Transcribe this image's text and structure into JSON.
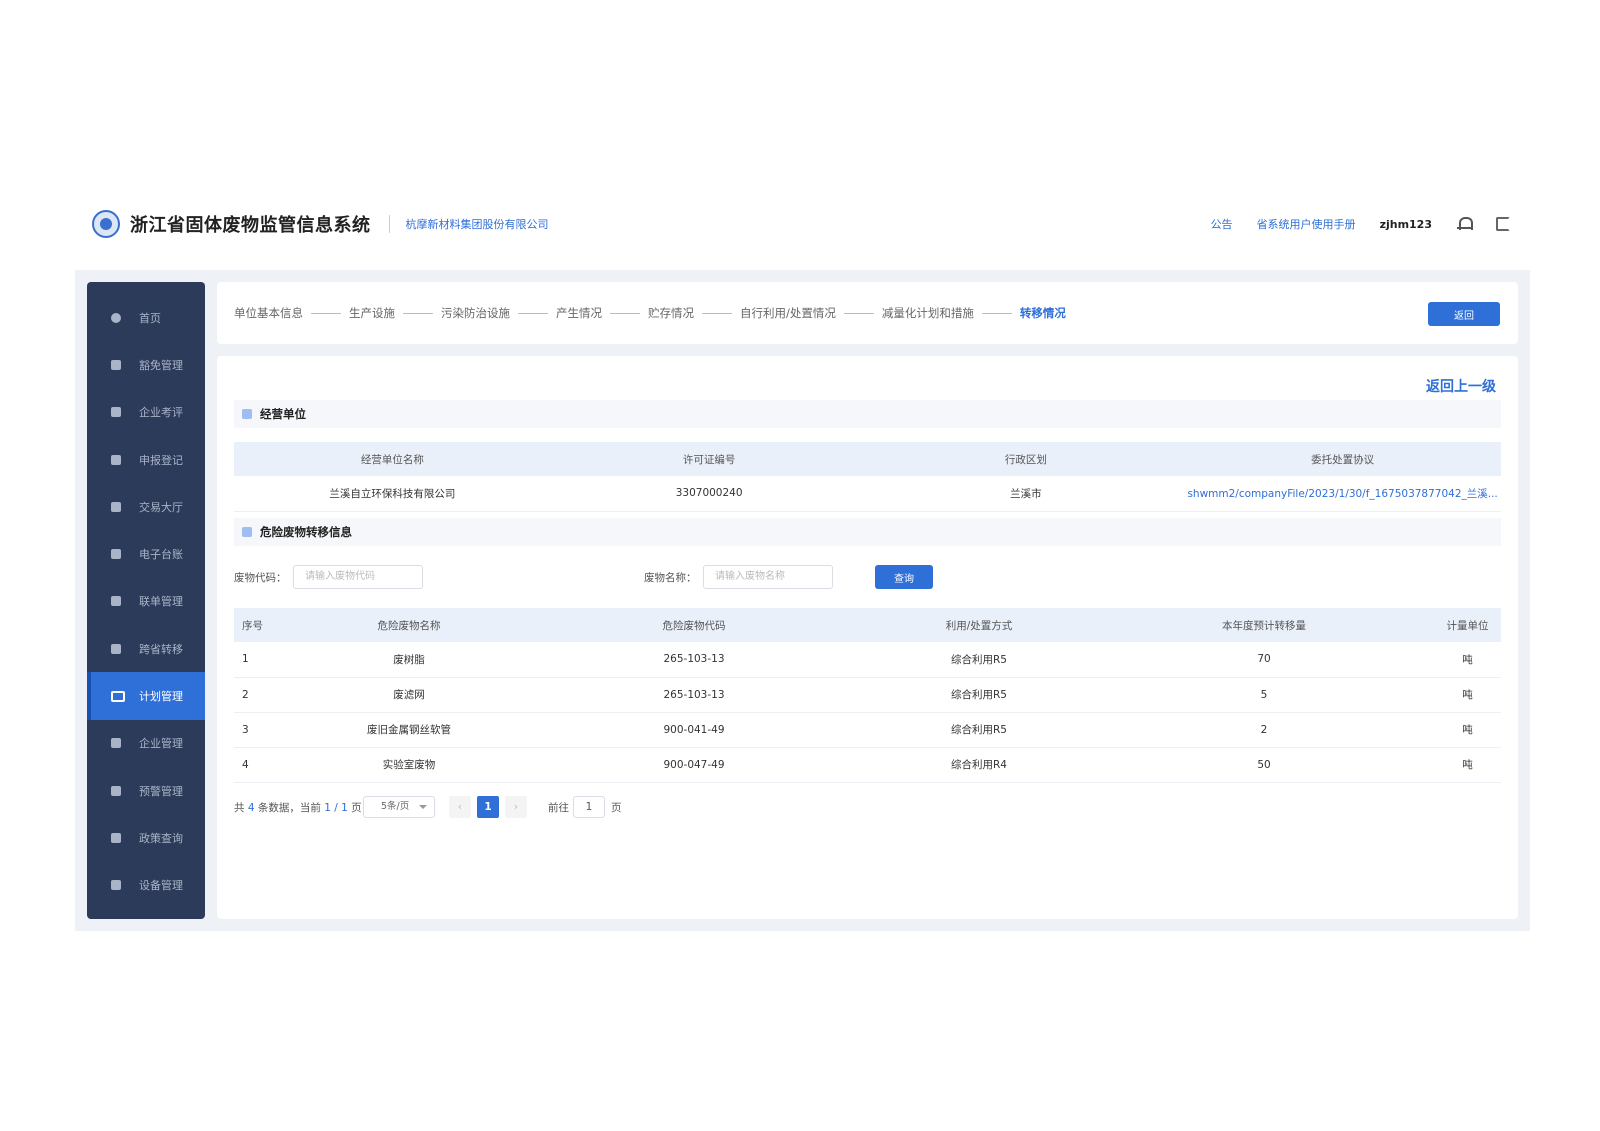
{
  "header": {
    "system_title": "浙江省固体废物监管信息系统",
    "company": "杭摩新材料集团股份有限公司",
    "notice": "公告",
    "manual": "省系统用户使用手册",
    "username": "zjhm123"
  },
  "sidebar": {
    "items": [
      {
        "label": "首页",
        "icon": "home-icon"
      },
      {
        "label": "豁免管理",
        "icon": "shield-icon"
      },
      {
        "label": "企业考评",
        "icon": "chat-icon"
      },
      {
        "label": "申报登记",
        "icon": "document-icon"
      },
      {
        "label": "交易大厅",
        "icon": "store-icon"
      },
      {
        "label": "电子台账",
        "icon": "ledger-icon"
      },
      {
        "label": "联单管理",
        "icon": "file-icon"
      },
      {
        "label": "跨省转移",
        "icon": "transfer-icon"
      },
      {
        "label": "计划管理",
        "icon": "camera-icon"
      },
      {
        "label": "企业管理",
        "icon": "building-icon"
      },
      {
        "label": "预警管理",
        "icon": "warning-icon"
      },
      {
        "label": "政策查询",
        "icon": "book-icon"
      },
      {
        "label": "设备管理",
        "icon": "device-icon"
      }
    ],
    "active_index": 8
  },
  "steps": [
    "单位基本信息",
    "生产设施",
    "污染防治设施",
    "产生情况",
    "贮存情况",
    "自行利用/处置情况",
    "减量化计划和措施",
    "转移情况"
  ],
  "active_step": 7,
  "top_back_button": "返回",
  "back_up_link": "返回上一级",
  "operating_unit": {
    "section_title": "经营单位",
    "columns": [
      "经营单位名称",
      "许可证编号",
      "行政区划",
      "委托处置协议"
    ],
    "rows": [
      [
        "兰溪自立环保科技有限公司",
        "3307000240",
        "兰溪市",
        "shwmm2/companyFile/2023/1/30/f_1675037877042_兰溪..."
      ]
    ]
  },
  "transfer_info": {
    "section_title": "危险废物转移信息",
    "filter": {
      "code_label": "废物代码：",
      "code_placeholder": "请输入废物代码",
      "name_label": "废物名称：",
      "name_placeholder": "请输入废物名称",
      "search_button": "查询"
    },
    "columns": [
      "序号",
      "危险废物名称",
      "危险废物代码",
      "利用/处置方式",
      "本年度预计转移量",
      "计量单位"
    ],
    "rows": [
      [
        "1",
        "废树脂",
        "265-103-13",
        "综合利用R5",
        "70",
        "吨"
      ],
      [
        "2",
        "废滤网",
        "265-103-13",
        "综合利用R5",
        "5",
        "吨"
      ],
      [
        "3",
        "废旧金属钢丝软管",
        "900-041-49",
        "综合利用R5",
        "2",
        "吨"
      ],
      [
        "4",
        "实验室废物",
        "900-047-49",
        "综合利用R4",
        "50",
        "吨"
      ]
    ]
  },
  "pagination": {
    "total_prefix": "共",
    "total": "4",
    "total_mid": "条数据，当前",
    "current_page": "1",
    "page_sep": "/",
    "total_pages": "1",
    "page_suffix": "页",
    "page_size": "5条/页",
    "prev": "‹",
    "next": "›",
    "goto_label": "前往",
    "goto_value": "1",
    "goto_suffix": "页"
  }
}
